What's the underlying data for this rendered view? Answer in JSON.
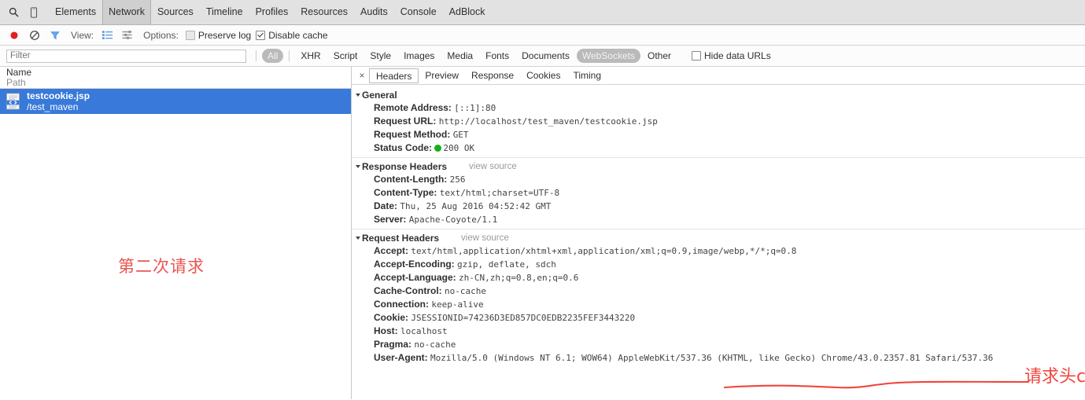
{
  "tabbar": {
    "search_icon": "search-icon",
    "device_icon": "device-toggle-icon",
    "tabs": [
      {
        "label": "Elements",
        "active": false
      },
      {
        "label": "Network",
        "active": true
      },
      {
        "label": "Sources",
        "active": false
      },
      {
        "label": "Timeline",
        "active": false
      },
      {
        "label": "Profiles",
        "active": false
      },
      {
        "label": "Resources",
        "active": false
      },
      {
        "label": "Audits",
        "active": false
      },
      {
        "label": "Console",
        "active": false
      },
      {
        "label": "AdBlock",
        "active": false
      }
    ]
  },
  "controls": {
    "record_icon": "record-circle-icon",
    "clear_icon": "clear-icon",
    "filter_icon": "funnel-icon",
    "view_label": "View:",
    "list_view_icon": "list-view-icon",
    "waterfall_icon": "waterfall-view-icon",
    "options_label": "Options:",
    "preserve_log": {
      "label": "Preserve log",
      "checked": false
    },
    "disable_cache": {
      "label": "Disable cache",
      "checked": true
    }
  },
  "filterbar": {
    "placeholder": "Filter",
    "value": "",
    "types": [
      {
        "label": "All",
        "selected": true
      },
      {
        "label": "XHR",
        "selected": false
      },
      {
        "label": "Script",
        "selected": false
      },
      {
        "label": "Style",
        "selected": false
      },
      {
        "label": "Images",
        "selected": false
      },
      {
        "label": "Media",
        "selected": false
      },
      {
        "label": "Fonts",
        "selected": false
      },
      {
        "label": "Documents",
        "selected": false
      },
      {
        "label": "WebSockets",
        "selected": true
      },
      {
        "label": "Other",
        "selected": false
      }
    ],
    "hide_data_urls": {
      "label": "Hide data URLs",
      "checked": false
    }
  },
  "request_list": {
    "column_name": "Name",
    "column_path": "Path",
    "rows": [
      {
        "name": "testcookie.jsp",
        "path": "/test_maven",
        "icon": "document-code-icon",
        "selected": true
      }
    ],
    "annotation": "第二次请求"
  },
  "detail": {
    "close_icon": "×",
    "tabs": [
      {
        "label": "Headers",
        "active": true
      },
      {
        "label": "Preview",
        "active": false
      },
      {
        "label": "Response",
        "active": false
      },
      {
        "label": "Cookies",
        "active": false
      },
      {
        "label": "Timing",
        "active": false
      }
    ],
    "view_source_label": "view source",
    "sections": [
      {
        "title": "General",
        "has_view_source": false,
        "rows": [
          {
            "key": "Remote Address:",
            "value": "[::1]:80"
          },
          {
            "key": "Request URL:",
            "value": "http://localhost/test_maven/testcookie.jsp"
          },
          {
            "key": "Request Method:",
            "value": "GET"
          },
          {
            "key": "Status Code:",
            "value": "200 OK",
            "status_dot": true
          }
        ]
      },
      {
        "title": "Response Headers",
        "has_view_source": true,
        "rows": [
          {
            "key": "Content-Length:",
            "value": "256"
          },
          {
            "key": "Content-Type:",
            "value": "text/html;charset=UTF-8"
          },
          {
            "key": "Date:",
            "value": "Thu, 25 Aug 2016 04:52:42 GMT"
          },
          {
            "key": "Server:",
            "value": "Apache-Coyote/1.1"
          }
        ]
      },
      {
        "title": "Request Headers",
        "has_view_source": true,
        "rows": [
          {
            "key": "Accept:",
            "value": "text/html,application/xhtml+xml,application/xml;q=0.9,image/webp,*/*;q=0.8"
          },
          {
            "key": "Accept-Encoding:",
            "value": "gzip, deflate, sdch"
          },
          {
            "key": "Accept-Language:",
            "value": "zh-CN,zh;q=0.8,en;q=0.6"
          },
          {
            "key": "Cache-Control:",
            "value": "no-cache"
          },
          {
            "key": "Connection:",
            "value": "keep-alive"
          },
          {
            "key": "Cookie:",
            "value": "JSESSIONID=74236D3ED857DC0EDB2235FEF3443220",
            "highlighted": true
          },
          {
            "key": "Host:",
            "value": "localhost"
          },
          {
            "key": "Pragma:",
            "value": "no-cache"
          },
          {
            "key": "User-Agent:",
            "value": "Mozilla/5.0 (Windows NT 6.1; WOW64) AppleWebKit/537.36 (KHTML, like Gecko) Chrome/43.0.2357.81 Safari/537.36"
          }
        ]
      }
    ],
    "annotation": "请求头cookie中，带着jsessionid信息"
  },
  "colors": {
    "selection_blue": "#3879d9",
    "annotation_red": "#f0453c",
    "status_green": "#17b017",
    "record_red": "#e02020",
    "accent_blue": "#4a90e2"
  }
}
